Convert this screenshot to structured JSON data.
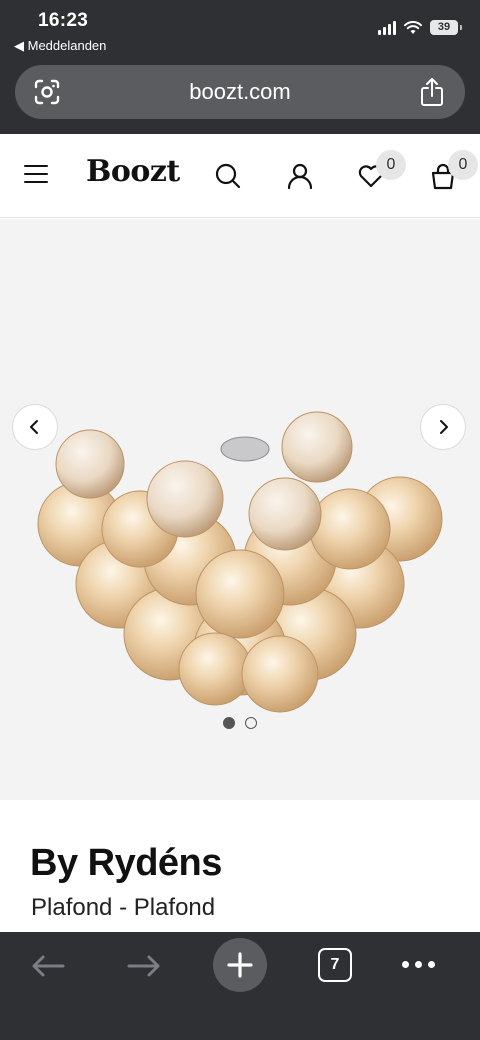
{
  "status_bar": {
    "time": "16:23",
    "back_label": "◀ Meddelanden",
    "battery": "39"
  },
  "browser": {
    "url": "boozt.com",
    "open_tabs": "7"
  },
  "site_header": {
    "logo": "Boozt",
    "wishlist_count": "0",
    "cart_count": "0"
  },
  "gallery": {
    "image_alt": "Glass bubble ceiling lamp",
    "current_image": 1,
    "total_images": 2
  },
  "product": {
    "brand": "By Rydéns",
    "subtitle": "Plafond - Plafond"
  },
  "icons": [
    "back-icon",
    "lens-icon",
    "share-icon",
    "menu-icon",
    "search-icon",
    "account-icon",
    "heart-icon",
    "bag-icon",
    "chevron-left-icon",
    "chevron-right-icon",
    "plus-icon"
  ],
  "colors": {
    "chrome": "#2e3033",
    "url_pill": "#5a5c60",
    "gallery_bg": "#f3f3f3"
  }
}
